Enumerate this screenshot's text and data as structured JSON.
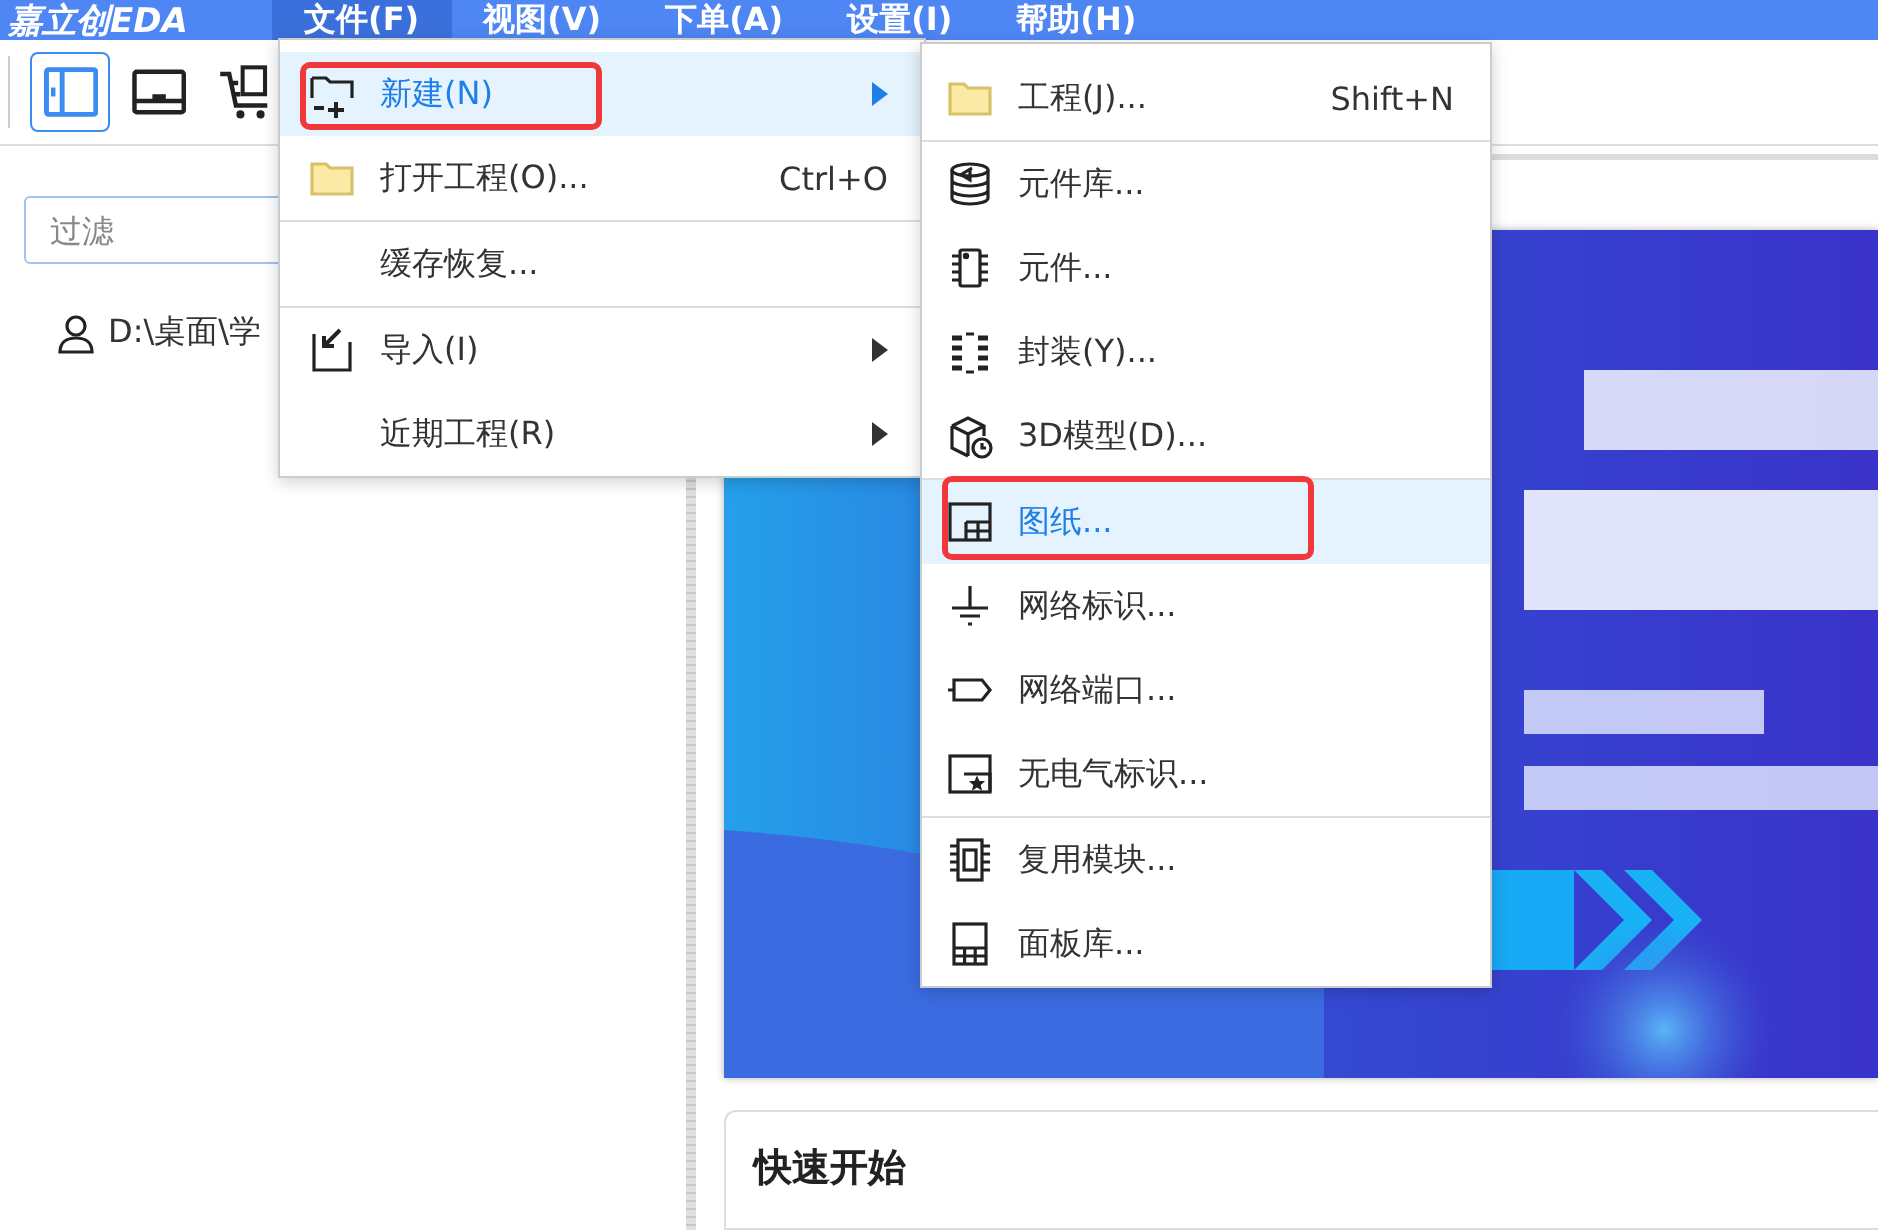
{
  "menubar": {
    "logo": "嘉立创EDA",
    "menus": [
      {
        "label": "文件(F)",
        "selected": true
      },
      {
        "label": "视图(V)",
        "selected": false
      },
      {
        "label": "下单(A)",
        "selected": false
      },
      {
        "label": "设置(I)",
        "selected": false
      },
      {
        "label": "帮助(H)",
        "selected": false
      }
    ]
  },
  "toolbar": {
    "buttons": [
      {
        "selected": true
      },
      {
        "selected": false
      },
      {
        "selected": false
      }
    ]
  },
  "sidebar": {
    "filter": {
      "placeholder": "过滤"
    },
    "tree": [
      {
        "label": "D:\\桌面\\学"
      }
    ]
  },
  "file_menu": {
    "groups": [
      [
        {
          "label": "新建(N)",
          "selected": true,
          "submenu": true,
          "annotated": true
        },
        {
          "label": "打开工程(O)...",
          "shortcut": "Ctrl+O",
          "selected": false,
          "submenu": false,
          "annotated": false
        }
      ],
      [
        {
          "label": "缓存恢复...",
          "selected": false,
          "submenu": false,
          "annotated": false
        }
      ],
      [
        {
          "label": "导入(I)",
          "selected": false,
          "submenu": true,
          "annotated": false
        },
        {
          "label": "近期工程(R)",
          "selected": false,
          "submenu": true,
          "annotated": false
        }
      ]
    ]
  },
  "new_submenu": {
    "groups": [
      [
        {
          "label": "工程(J)...",
          "shortcut": "Shift+N",
          "selected": false,
          "annotated": false
        }
      ],
      [
        {
          "label": "元件库...",
          "selected": false,
          "annotated": false
        },
        {
          "label": "元件...",
          "selected": false,
          "annotated": false
        },
        {
          "label": "封装(Y)...",
          "selected": false,
          "annotated": false
        },
        {
          "label": "3D模型(D)...",
          "selected": false,
          "annotated": false
        }
      ],
      [
        {
          "label": "图纸...",
          "selected": true,
          "annotated": true
        },
        {
          "label": "网络标识...",
          "selected": false,
          "annotated": false
        },
        {
          "label": "网络端口...",
          "selected": false,
          "annotated": false
        },
        {
          "label": "无电气标识...",
          "selected": false,
          "annotated": false
        }
      ],
      [
        {
          "label": "复用模块...",
          "selected": false,
          "annotated": false
        },
        {
          "label": "面板库...",
          "selected": false,
          "annotated": false
        }
      ]
    ]
  },
  "quick_start": {
    "title": "快速开始"
  }
}
